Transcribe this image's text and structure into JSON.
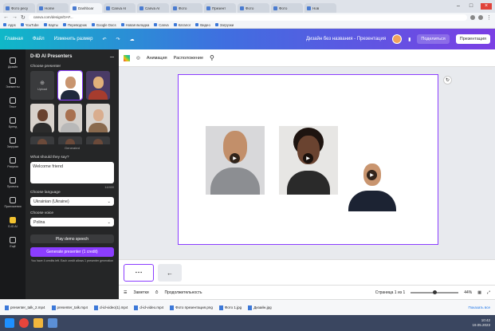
{
  "browser": {
    "tabs": [
      "Фото ресу",
      "Home",
      "Dashboar",
      "Canva AI",
      "Canva AI",
      "Фото",
      "Презент",
      "Фото",
      "Фото",
      "Нов"
    ],
    "active_tab_index": 2,
    "url": "canva.com/design/DAF...",
    "bookmarks": [
      "Apps",
      "YouTube",
      "Карты",
      "Переводчик",
      "Google Docs",
      "Новая вкладка",
      "Canva",
      "Каталог",
      "Видео",
      "Загрузки"
    ]
  },
  "canva_header": {
    "home": "Главная",
    "file": "Файл",
    "resize": "Изменить размер",
    "title": "Дизайн без названия - Презентация",
    "share": "Поделиться",
    "present": "Презентация"
  },
  "rail": {
    "items": [
      "Дизайн",
      "Элементы",
      "Текст",
      "Бренд",
      "Загрузки",
      "Рисунок",
      "Проекты",
      "Приложения",
      "D-ID AI",
      "Ещё"
    ]
  },
  "panel": {
    "title": "D-ID AI Presenters",
    "menu": "...",
    "choose_presenter": "Choose presenter",
    "upload": "Upload",
    "generated": "Generated",
    "text_label": "What should they say?",
    "text_value": "Welcome friend",
    "counter": "14/400",
    "language_label": "Choose language",
    "language_value": "Ukrainian (Ukraine)",
    "voice_label": "Choose voice",
    "voice_value": "Polina",
    "voice_button": "Play demo speech",
    "generate_button": "Generate presenter (1 credit)",
    "note": "You have 4 credits left. Each credit allows 1 presenter generation"
  },
  "editor": {
    "animate": "Анимация",
    "position": "Расположение",
    "page_label": "Страница 1 из 1",
    "notes": "Заметки",
    "duration": "Продолжительность",
    "zoom": "44%"
  },
  "downloads": [
    "presenter_talk_2.mp4",
    "presenter_talk.mp4",
    "d-id-video(1).mp4",
    "d-id-video.mp4",
    "Фото презентация.png",
    "Фото 1.jpg",
    "Дизайн.jpg"
  ],
  "downloads_show_all": "Показать все",
  "taskbar": {
    "time": "10:42",
    "date": "19.05.2023"
  },
  "colors": {
    "accent": "#8b3dff",
    "panel_bg": "#252627",
    "rail_bg": "#18191b"
  }
}
